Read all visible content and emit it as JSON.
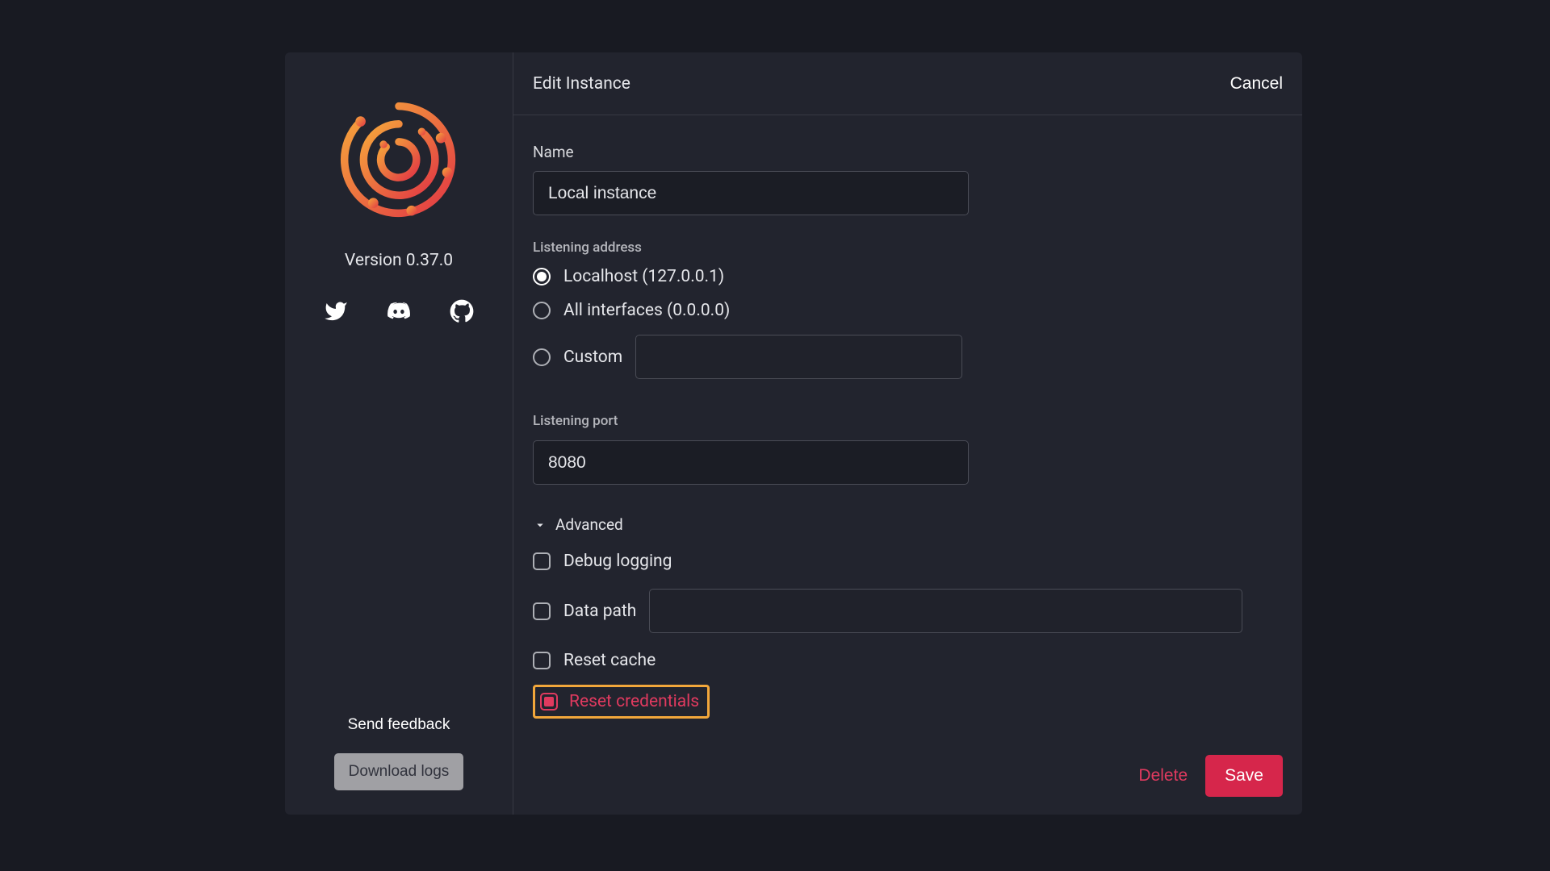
{
  "sidebar": {
    "version_label": "Version 0.37.0",
    "send_feedback_label": "Send feedback",
    "download_logs_label": "Download logs"
  },
  "header": {
    "title": "Edit Instance",
    "cancel_label": "Cancel"
  },
  "form": {
    "name_label": "Name",
    "name_value": "Local instance",
    "listening_address_label": "Listening address",
    "address_options": {
      "localhost": "Localhost (127.0.0.1)",
      "all": "All interfaces (0.0.0.0)",
      "custom": "Custom"
    },
    "address_selected": "localhost",
    "custom_address_value": "",
    "listening_port_label": "Listening port",
    "listening_port_value": "8080",
    "advanced_label": "Advanced",
    "debug_logging_label": "Debug logging",
    "debug_logging_checked": false,
    "data_path_label": "Data path",
    "data_path_checked": false,
    "data_path_value": "",
    "reset_cache_label": "Reset cache",
    "reset_cache_checked": false,
    "reset_credentials_label": "Reset credentials",
    "reset_credentials_checked": true
  },
  "footer": {
    "delete_label": "Delete",
    "save_label": "Save"
  },
  "colors": {
    "accent_red": "#d6264b",
    "highlight_orange": "#f2a73b",
    "bg_modal": "#22242e",
    "bg_app": "#181a22"
  }
}
